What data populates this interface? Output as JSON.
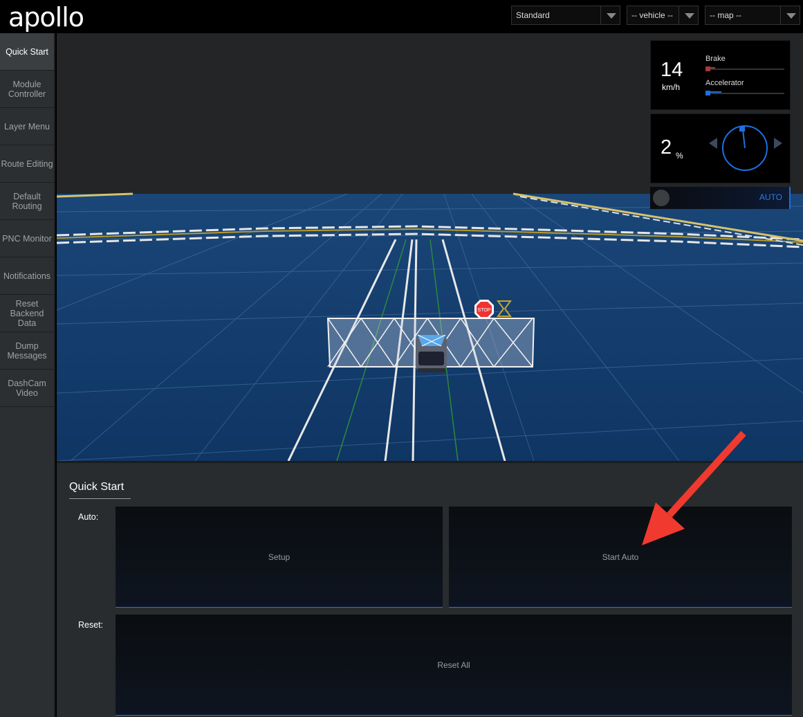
{
  "header": {
    "logo": "apollo",
    "mode_select": "Standard",
    "vehicle_select": "-- vehicle --",
    "map_select": "-- map --"
  },
  "sidebar": {
    "items": [
      {
        "label": "Quick Start",
        "active": true
      },
      {
        "label": "Module Controller"
      },
      {
        "label": "Layer Menu"
      },
      {
        "label": "Route Editing"
      },
      {
        "label": "Default Routing"
      },
      {
        "label": "PNC Monitor"
      },
      {
        "label": "Notifications"
      },
      {
        "label": "Reset Backend Data"
      },
      {
        "label": "Dump Messages"
      },
      {
        "label": "DashCam Video"
      }
    ]
  },
  "dashboard": {
    "speed": "14",
    "speed_unit": "km/h",
    "brake_label": "Brake",
    "brake_level": 0.12,
    "accelerator_label": "Accelerator",
    "accelerator_level": 0.2,
    "steering": "2",
    "steering_unit": "%",
    "drive_mode": "AUTO"
  },
  "scene": {
    "stop_sign": "STOP"
  },
  "quick_start": {
    "title": "Quick Start",
    "auto_label": "Auto:",
    "setup_button": "Setup",
    "start_auto_button": "Start Auto",
    "reset_label": "Reset:",
    "reset_all_button": "Reset All"
  },
  "colors": {
    "accent_blue": "#1e6fe0",
    "brake_red": "#a33a3a",
    "ground": "#123a68",
    "annotation_arrow": "#f03a30"
  }
}
